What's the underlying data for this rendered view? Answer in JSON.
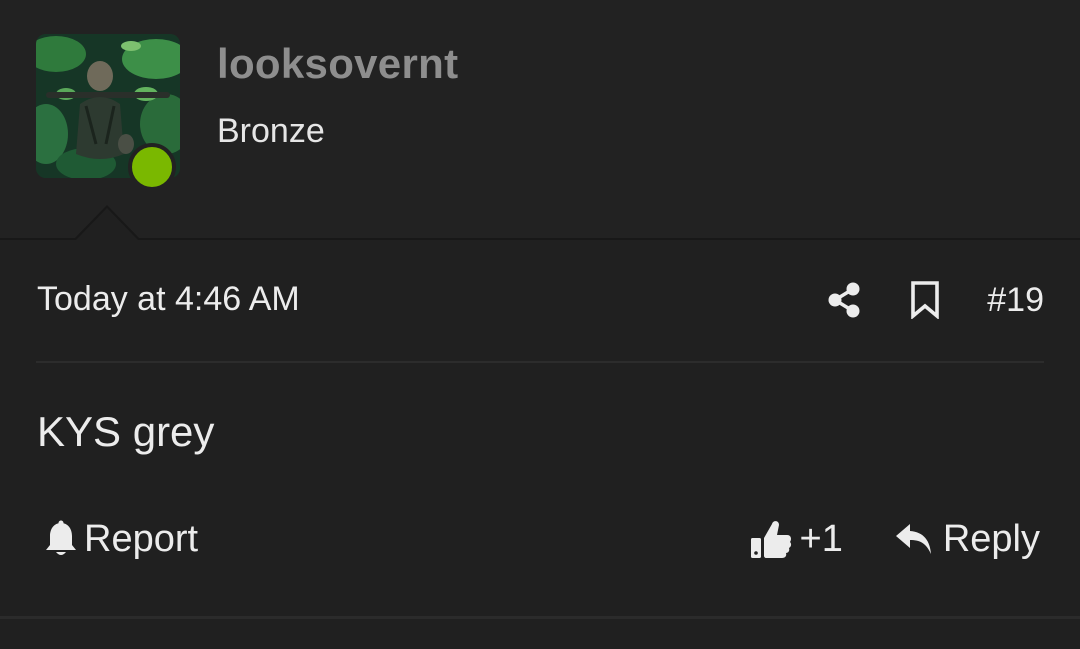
{
  "user": {
    "username": "looksovernt",
    "title": "Bronze",
    "online": true,
    "avatar_icon": "avatar-image",
    "status_color": "#7ab800"
  },
  "post": {
    "timestamp": "Today at 4:46 AM",
    "number": "#19",
    "body": "KYS grey"
  },
  "actions": {
    "share_icon": "share-icon",
    "bookmark_icon": "bookmark-icon",
    "report_label": "Report",
    "like_count": "+1",
    "reply_label": "Reply"
  },
  "colors": {
    "background": "#202020",
    "username": "#8e8e8e",
    "text": "#ececec"
  }
}
